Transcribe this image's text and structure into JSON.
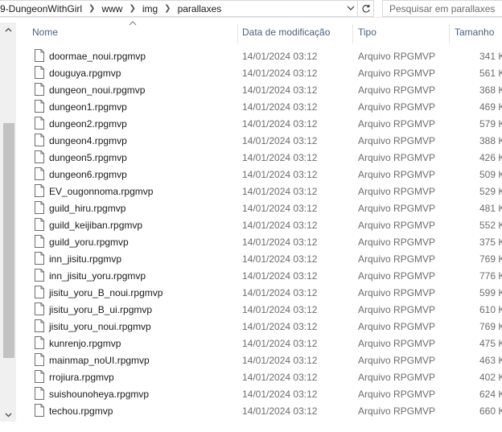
{
  "address_bar": {
    "crumbs": [
      "9-DungeonWithGirl",
      "www",
      "img",
      "parallaxes"
    ]
  },
  "search": {
    "placeholder": "Pesquisar em parallaxes"
  },
  "columns": {
    "name": "Nome",
    "date": "Data de modificação",
    "type": "Tipo",
    "size": "Tamanho"
  },
  "files": [
    {
      "name": "doormae_noui.rpgmvp",
      "date": "14/01/2024 03:12",
      "type": "Arquivo RPGMVP",
      "size": "341 K"
    },
    {
      "name": "douguya.rpgmvp",
      "date": "14/01/2024 03:12",
      "type": "Arquivo RPGMVP",
      "size": "561 K"
    },
    {
      "name": "dungeon_noui.rpgmvp",
      "date": "14/01/2024 03:12",
      "type": "Arquivo RPGMVP",
      "size": "368 K"
    },
    {
      "name": "dungeon1.rpgmvp",
      "date": "14/01/2024 03:12",
      "type": "Arquivo RPGMVP",
      "size": "469 K"
    },
    {
      "name": "dungeon2.rpgmvp",
      "date": "14/01/2024 03:12",
      "type": "Arquivo RPGMVP",
      "size": "579 K"
    },
    {
      "name": "dungeon4.rpgmvp",
      "date": "14/01/2024 03:12",
      "type": "Arquivo RPGMVP",
      "size": "388 K"
    },
    {
      "name": "dungeon5.rpgmvp",
      "date": "14/01/2024 03:12",
      "type": "Arquivo RPGMVP",
      "size": "426 K"
    },
    {
      "name": "dungeon6.rpgmvp",
      "date": "14/01/2024 03:12",
      "type": "Arquivo RPGMVP",
      "size": "509 K"
    },
    {
      "name": "EV_ougonnoma.rpgmvp",
      "date": "14/01/2024 03:12",
      "type": "Arquivo RPGMVP",
      "size": "529 K"
    },
    {
      "name": "guild_hiru.rpgmvp",
      "date": "14/01/2024 03:12",
      "type": "Arquivo RPGMVP",
      "size": "481 K"
    },
    {
      "name": "guild_keijiban.rpgmvp",
      "date": "14/01/2024 03:12",
      "type": "Arquivo RPGMVP",
      "size": "552 K"
    },
    {
      "name": "guild_yoru.rpgmvp",
      "date": "14/01/2024 03:12",
      "type": "Arquivo RPGMVP",
      "size": "375 K"
    },
    {
      "name": "inn_jisitu.rpgmvp",
      "date": "14/01/2024 03:12",
      "type": "Arquivo RPGMVP",
      "size": "769 K"
    },
    {
      "name": "inn_jisitu_yoru.rpgmvp",
      "date": "14/01/2024 03:12",
      "type": "Arquivo RPGMVP",
      "size": "776 K"
    },
    {
      "name": "jisitu_yoru_B_noui.rpgmvp",
      "date": "14/01/2024 03:12",
      "type": "Arquivo RPGMVP",
      "size": "599 K"
    },
    {
      "name": "jisitu_yoru_B_ui.rpgmvp",
      "date": "14/01/2024 03:12",
      "type": "Arquivo RPGMVP",
      "size": "610 K"
    },
    {
      "name": "jisitu_yoru_noui.rpgmvp",
      "date": "14/01/2024 03:12",
      "type": "Arquivo RPGMVP",
      "size": "769 K"
    },
    {
      "name": "kunrenjo.rpgmvp",
      "date": "14/01/2024 03:12",
      "type": "Arquivo RPGMVP",
      "size": "475 K"
    },
    {
      "name": "mainmap_noUI.rpgmvp",
      "date": "14/01/2024 03:12",
      "type": "Arquivo RPGMVP",
      "size": "463 K"
    },
    {
      "name": "rrojiura.rpgmvp",
      "date": "14/01/2024 03:12",
      "type": "Arquivo RPGMVP",
      "size": "402 K"
    },
    {
      "name": "suishounoheya.rpgmvp",
      "date": "14/01/2024 03:12",
      "type": "Arquivo RPGMVP",
      "size": "624 K"
    },
    {
      "name": "techou.rpgmvp",
      "date": "14/01/2024 03:12",
      "type": "Arquivo RPGMVP",
      "size": "660 K"
    }
  ]
}
